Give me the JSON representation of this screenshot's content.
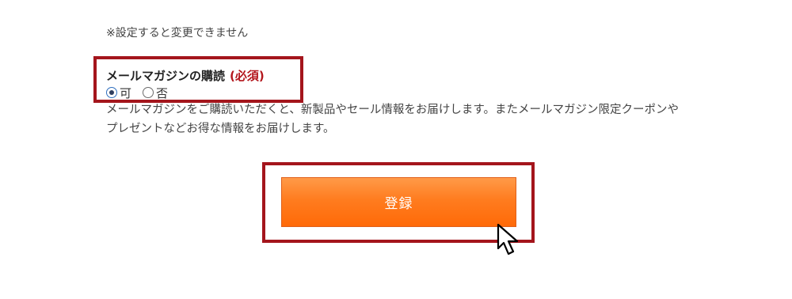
{
  "note": "※設定すると変更できません",
  "newsletter": {
    "label": "メールマガジンの購読",
    "required": "(必須)",
    "options": [
      {
        "label": "可",
        "checked": true
      },
      {
        "label": "否",
        "checked": false
      }
    ],
    "description": "メールマガジンをご購読いただくと、新製品やセール情報をお届けします。またメールマガジン限定クーポンやプレゼントなどお得な情報をお届けします。"
  },
  "submit": {
    "label": "登録"
  },
  "colors": {
    "highlight": "#a4151c",
    "required": "#b3161c",
    "button": "#ff7c1f"
  },
  "icons": {
    "pointer": "arrow-cursor-icon"
  }
}
